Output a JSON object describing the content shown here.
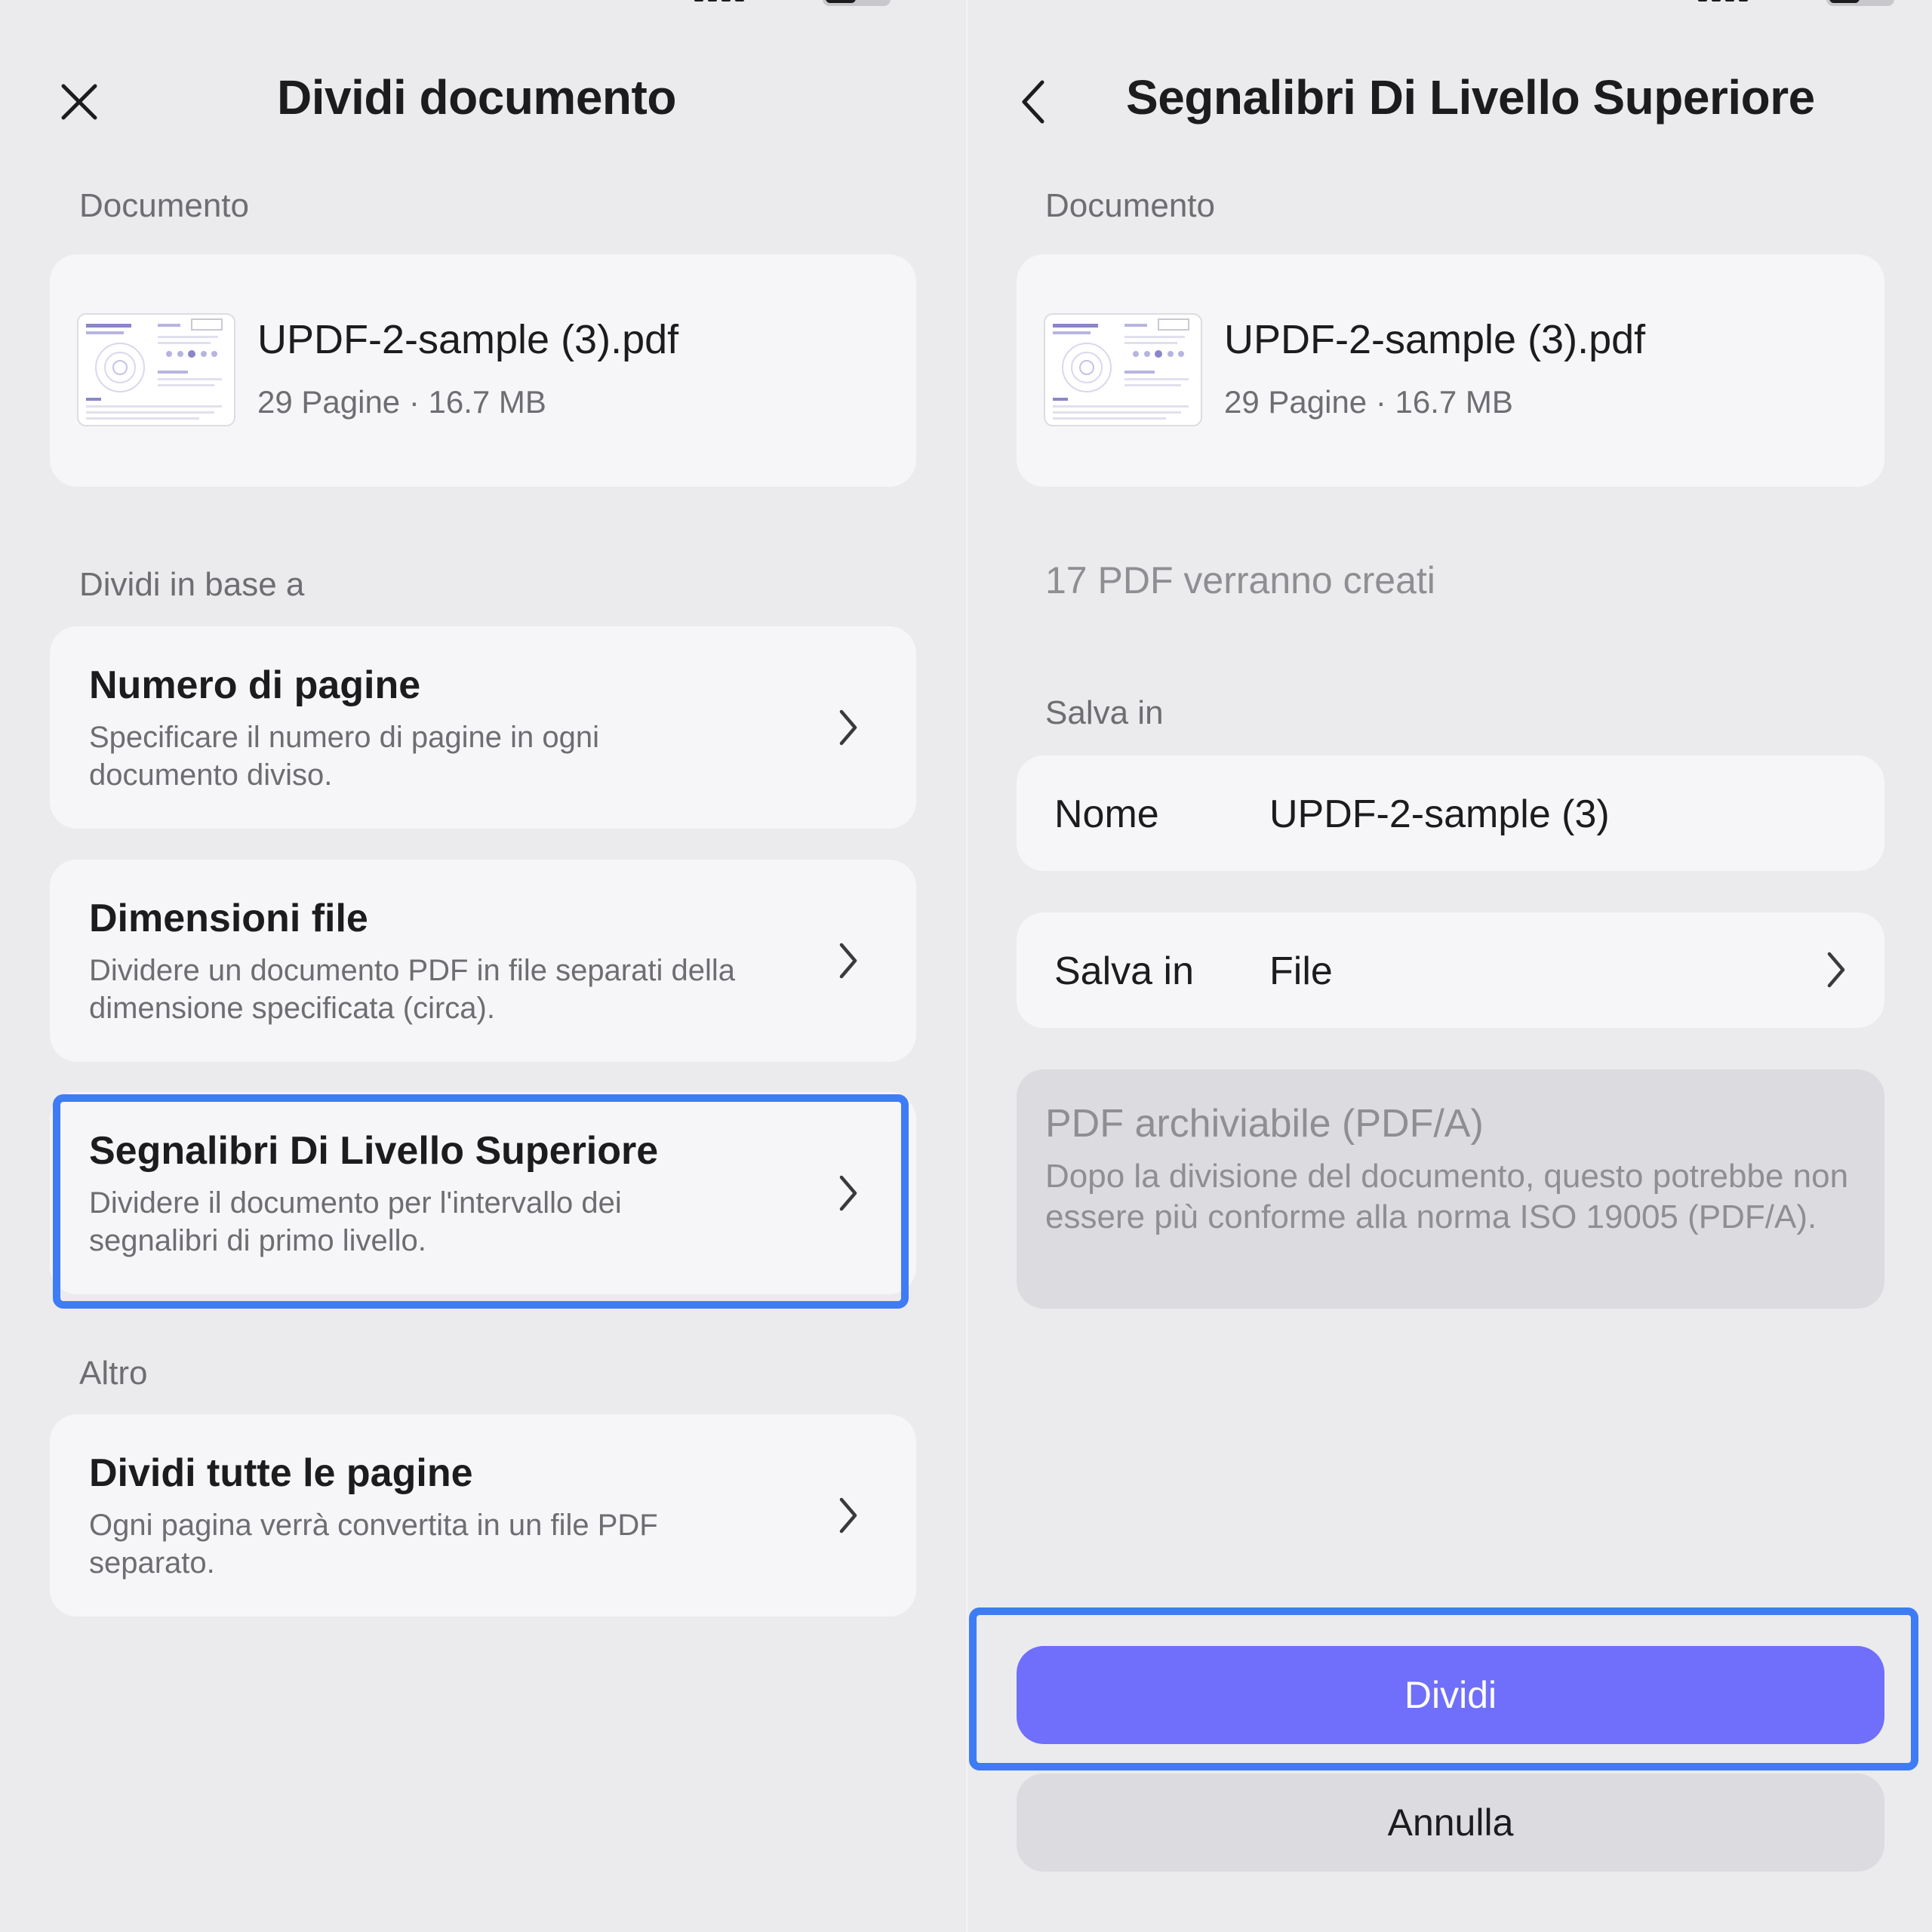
{
  "left": {
    "title": "Dividi documento",
    "close_icon": "close-icon",
    "document_label": "Documento",
    "document": {
      "name": "UPDF-2-sample (3).pdf",
      "meta": "29 Pagine · 16.7 MB"
    },
    "split_by_label": "Dividi in base a",
    "options": [
      {
        "title": "Numero di pagine",
        "desc": "Specificare il numero di pagine in ogni documento diviso."
      },
      {
        "title": "Dimensioni file",
        "desc": "Dividere un documento PDF in file separati della dimensione specificata (circa)."
      },
      {
        "title": "Segnalibri Di Livello Superiore",
        "desc": "Dividere il documento per l'intervallo dei segnalibri di primo livello.",
        "selected": true
      }
    ],
    "other_label": "Altro",
    "other_options": [
      {
        "title": "Dividi tutte le pagine",
        "desc": "Ogni pagina verrà convertita in un file PDF separato."
      }
    ]
  },
  "right": {
    "title": "Segnalibri Di Livello Superiore",
    "back_icon": "chevron-left-icon",
    "document_label": "Documento",
    "document": {
      "name": "UPDF-2-sample (3).pdf",
      "meta": "29 Pagine · 16.7 MB"
    },
    "info": "17 PDF verranno creati",
    "save_section_label": "Salva in",
    "name_row": {
      "label": "Nome",
      "value": "UPDF-2-sample (3)"
    },
    "location_row": {
      "label": "Salva in",
      "value": "File"
    },
    "pdfa": {
      "title": "PDF archiviabile (PDF/A)",
      "desc": "Dopo la divisione del documento, questo potrebbe non essere più conforme alla norma ISO 19005 (PDF/A)."
    },
    "primary_button": "Dividi",
    "secondary_button": "Annulla"
  },
  "colors": {
    "accent": "#6f6ffb",
    "highlight": "#3d7cf5",
    "background": "#ebebed",
    "card": "#f6f6f8"
  }
}
